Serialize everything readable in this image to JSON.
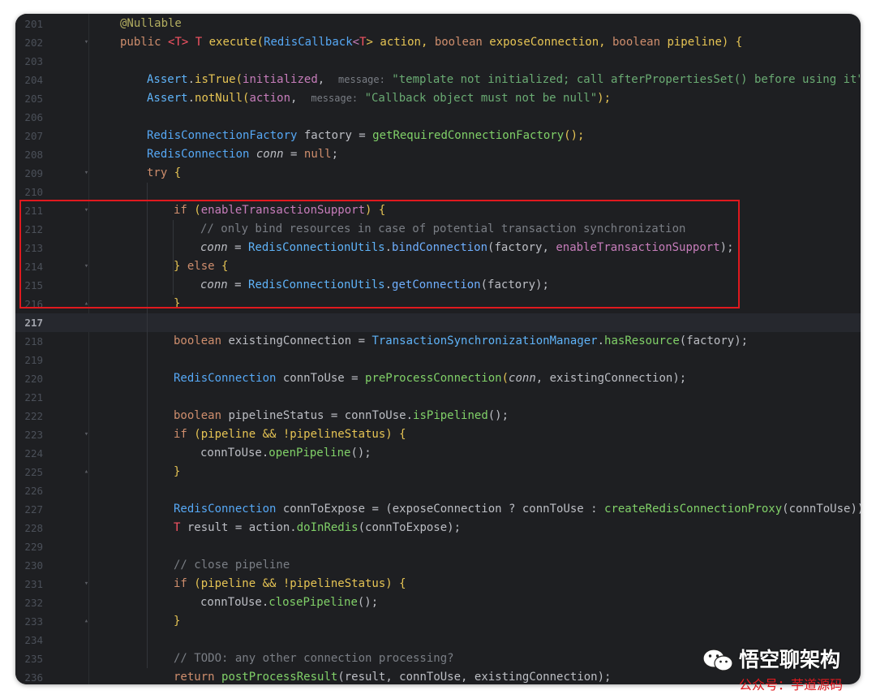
{
  "editor": {
    "current_line": "217",
    "lines": [
      {
        "n": "201"
      },
      {
        "n": "202"
      },
      {
        "n": "203"
      },
      {
        "n": "204"
      },
      {
        "n": "205"
      },
      {
        "n": "206"
      },
      {
        "n": "207"
      },
      {
        "n": "208"
      },
      {
        "n": "209"
      },
      {
        "n": "210"
      },
      {
        "n": "211"
      },
      {
        "n": "212"
      },
      {
        "n": "213"
      },
      {
        "n": "214"
      },
      {
        "n": "215"
      },
      {
        "n": "216"
      },
      {
        "n": "217"
      },
      {
        "n": "218"
      },
      {
        "n": "219"
      },
      {
        "n": "220"
      },
      {
        "n": "221"
      },
      {
        "n": "222"
      },
      {
        "n": "223"
      },
      {
        "n": "224"
      },
      {
        "n": "225"
      },
      {
        "n": "226"
      },
      {
        "n": "227"
      },
      {
        "n": "228"
      },
      {
        "n": "229"
      },
      {
        "n": "230"
      },
      {
        "n": "231"
      },
      {
        "n": "232"
      },
      {
        "n": "233"
      },
      {
        "n": "234"
      },
      {
        "n": "235"
      },
      {
        "n": "236"
      }
    ],
    "code": {
      "l201": "@Nullable",
      "l202": [
        "public ",
        "<",
        "T",
        "> ",
        "T",
        " ",
        "execute",
        "(",
        "RedisCallback",
        "<",
        "T",
        "> action, ",
        "boolean",
        " exposeConnection, ",
        "boolean",
        " pipeline) {"
      ],
      "l204": [
        "Assert",
        ".",
        "isTrue",
        "(",
        "initialized",
        ",  ",
        "message:",
        " ",
        "\"template not initialized; call afterPropertiesSet() before using it\"",
        ");"
      ],
      "l205": [
        "Assert",
        ".",
        "notNull",
        "(",
        "action",
        ",  ",
        "message:",
        " ",
        "\"Callback object must not be null\"",
        ");"
      ],
      "l207": [
        "RedisConnectionFactory",
        " factory = ",
        "getRequiredConnectionFactory",
        "();"
      ],
      "l208": [
        "RedisConnection",
        " ",
        "conn",
        " = ",
        "null",
        ";"
      ],
      "l209": [
        "try",
        " {"
      ],
      "l211": [
        "if",
        " (",
        "enableTransactionSupport",
        ") {"
      ],
      "l212": "// only bind resources in case of potential transaction synchronization",
      "l213": [
        "conn",
        " = ",
        "RedisConnectionUtils",
        ".",
        "bindConnection",
        "(factory, ",
        "enableTransactionSupport",
        ");"
      ],
      "l214": [
        "} ",
        "else",
        " {"
      ],
      "l215": [
        "conn",
        " = ",
        "RedisConnectionUtils",
        ".",
        "getConnection",
        "(factory);"
      ],
      "l216": "}",
      "l218": [
        "boolean",
        " existingConnection = ",
        "TransactionSynchronizationManager",
        ".",
        "hasResource",
        "(factory);"
      ],
      "l220": [
        "RedisConnection",
        " connToUse = ",
        "preProcessConnection",
        "(",
        "conn",
        ", existingConnection);"
      ],
      "l222": [
        "boolean",
        " pipelineStatus = connToUse.",
        "isPipelined",
        "();"
      ],
      "l223": [
        "if",
        " (pipeline && !pipelineStatus) {"
      ],
      "l224": [
        "connToUse.",
        "openPipeline",
        "();"
      ],
      "l225": "}",
      "l227": [
        "RedisConnection",
        " connToExpose = (exposeConnection ? connToUse : ",
        "createRedisConnectionProxy",
        "(connToUse));"
      ],
      "l228": [
        "T",
        " result = action.",
        "doInRedis",
        "(connToExpose);"
      ],
      "l230": "// close pipeline",
      "l231": [
        "if",
        " (pipeline && !pipelineStatus) {"
      ],
      "l232": [
        "connToUse.",
        "closePipeline",
        "();"
      ],
      "l233": "}",
      "l235": "// TODO: any other connection processing?",
      "l236": [
        "return",
        " ",
        "postProcessResult",
        "(result, connToUse, existingConnection);"
      ]
    }
  },
  "watermark": {
    "title": "悟空聊架构",
    "subtitle": "公众号：芋道源码",
    "icon": "wechat-icon"
  },
  "colors": {
    "background": "#1e1f22",
    "highlight_box": "#e0191e",
    "keyword": "#cf8e6d",
    "string": "#6aab73",
    "comment": "#7a7e85",
    "annotation": "#b3ae60",
    "type": "#56a8f5"
  }
}
